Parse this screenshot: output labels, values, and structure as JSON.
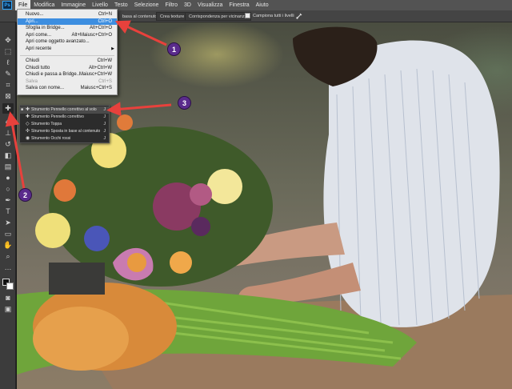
{
  "app": {
    "logo_text": "Ps"
  },
  "menubar": {
    "items": [
      "File",
      "Modifica",
      "Immagine",
      "Livello",
      "Testo",
      "Selezione",
      "Filtro",
      "3D",
      "Visualizza",
      "Finestra",
      "Aiuto"
    ],
    "active": "File"
  },
  "options_bar": {
    "fragment_label": "basa al contenuto",
    "button_texture": "Crea texture",
    "button_proximity": "Corrispondenza per vicinanza",
    "checkbox_label": "Campiona tutti i livelli",
    "angle_icon": "pressure-icon"
  },
  "file_menu": {
    "items": [
      {
        "label": "Nuovo...",
        "shortcut": "Ctrl+N"
      },
      {
        "label": "Apri...",
        "shortcut": "Ctrl+O",
        "highlighted": true
      },
      {
        "label": "Sfoglia in Bridge...",
        "shortcut": "Alt+Ctrl+O"
      },
      {
        "label": "Apri come...",
        "shortcut": "Alt+Maiusc+Ctrl+O"
      },
      {
        "label": "Apri come oggetto avanzato...",
        "shortcut": ""
      },
      {
        "label": "Apri recente",
        "shortcut": "",
        "submenu": true
      },
      {
        "separator": true
      },
      {
        "label": "Chiudi",
        "shortcut": "Ctrl+W"
      },
      {
        "label": "Chiudi tutto",
        "shortcut": "Alt+Ctrl+W"
      },
      {
        "label": "Chiudi e passa a Bridge...",
        "shortcut": "Maiusc+Ctrl+W"
      },
      {
        "label": "Salva",
        "shortcut": "Ctrl+S",
        "disabled": true
      },
      {
        "label": "Salva con nome...",
        "shortcut": "Maiusc+Ctrl+S"
      }
    ]
  },
  "tool_flyout": {
    "items": [
      {
        "label": "Strumento Pennello correttivo al volo",
        "key": "J",
        "active": true
      },
      {
        "label": "Strumento Pennello correttivo",
        "key": "J"
      },
      {
        "label": "Strumento Toppa",
        "key": "J"
      },
      {
        "label": "Strumento Sposta in base al contenuto",
        "key": "J"
      },
      {
        "label": "Strumento Occhi rossi",
        "key": "J"
      }
    ]
  },
  "callouts": [
    "1",
    "2",
    "3"
  ],
  "colors": {
    "arrow": "#e8413c",
    "badge": "#5a2b8c",
    "menu_highlight": "#3d8ee0"
  }
}
